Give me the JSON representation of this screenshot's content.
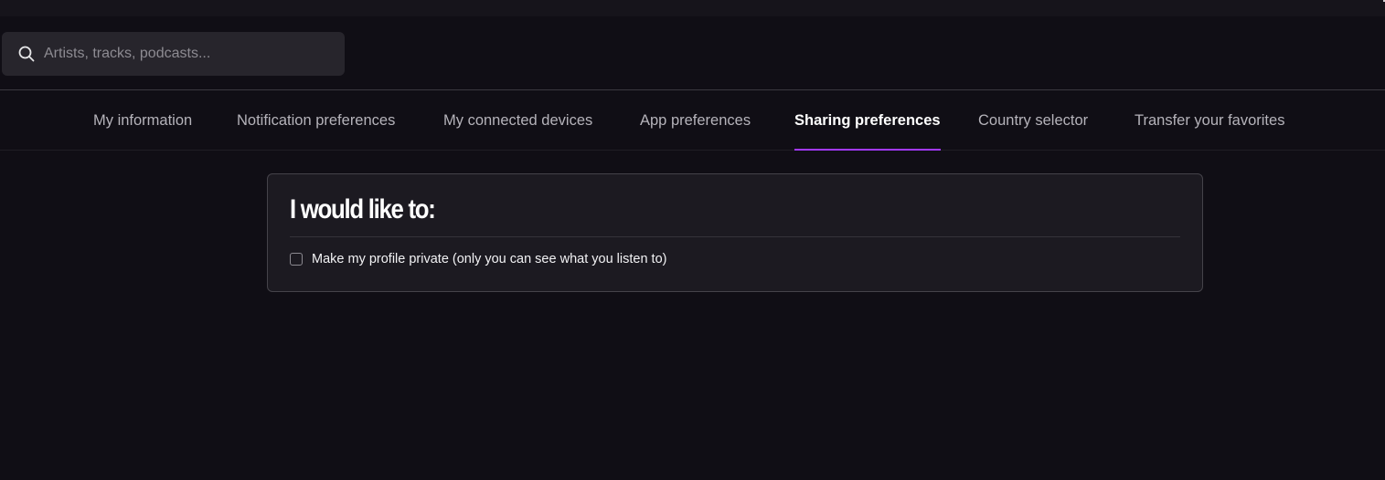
{
  "search": {
    "placeholder": "Artists, tracks, podcasts...",
    "icon": "search-icon"
  },
  "tabs": [
    {
      "label": "My information",
      "active": false
    },
    {
      "label": "Notification preferences",
      "active": false
    },
    {
      "label": "My connected devices",
      "active": false
    },
    {
      "label": "App preferences",
      "active": false
    },
    {
      "label": "Sharing preferences",
      "active": true
    },
    {
      "label": "Country selector",
      "active": false
    },
    {
      "label": "Transfer your favorites",
      "active": false
    }
  ],
  "card": {
    "title": "I would like to:",
    "options": [
      {
        "label": "Make my profile private (only you can see what you listen to)",
        "checked": false
      }
    ]
  },
  "colors": {
    "background": "#100e15",
    "accent": "#a238ff",
    "card_background": "#1c1a21"
  }
}
